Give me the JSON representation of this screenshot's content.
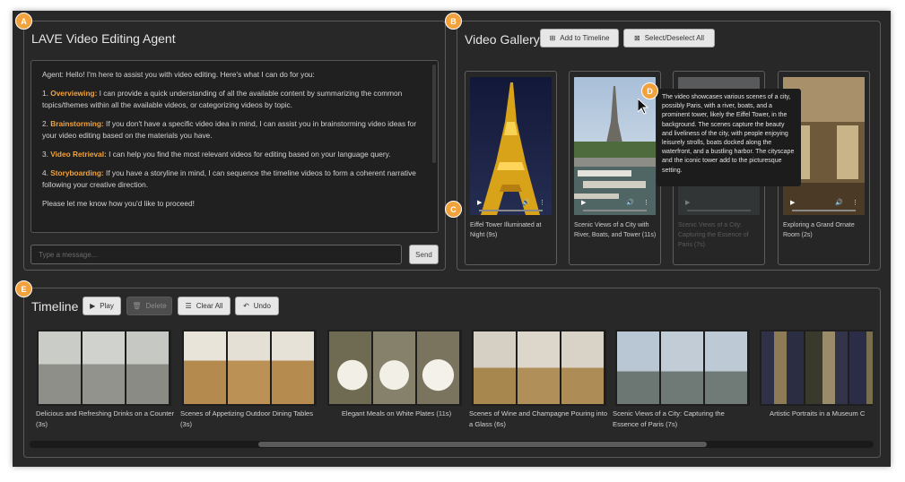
{
  "markers": [
    "A",
    "B",
    "C",
    "D",
    "E"
  ],
  "agent_panel": {
    "title": "LAVE Video Editing Agent",
    "intro": "Agent: Hello! I'm here to assist you with video editing. Here's what I can do for you:",
    "items": [
      {
        "num": "1.",
        "name": "Overviewing:",
        "text": " I can provide a quick understanding of all the available content by summarizing the common topics/themes within all the available videos, or categorizing videos by topic."
      },
      {
        "num": "2.",
        "name": "Brainstorming:",
        "text": " If you don't have a specific video idea in mind, I can assist you in brainstorming video ideas for your video editing based on the materials you have."
      },
      {
        "num": "3.",
        "name": "Video Retrieval:",
        "text": " I can help you find the most relevant videos for editing based on your language query."
      },
      {
        "num": "4.",
        "name": "Storyboarding:",
        "text": " If you have a storyline in mind, I can sequence the timeline videos to form a coherent narrative following your creative direction."
      }
    ],
    "closing": "Please let me know how you'd like to proceed!",
    "input_placeholder": "Type a message...",
    "send_label": "Send"
  },
  "gallery": {
    "title": "Video Gallery",
    "add_label": "Add to Timeline",
    "select_label": "Select/Deselect All",
    "videos": [
      {
        "caption": "Eiffel Tower Illuminated at Night (9s)"
      },
      {
        "caption": "Scenic Views of a City with River, Boats, and Tower (11s)"
      },
      {
        "caption": "Scenic Views of a City: Capturing the Essence of Paris (7s)"
      },
      {
        "caption": "Exploring a Grand Ornate Room (2s)"
      }
    ],
    "tooltip": "The video showcases various scenes of a city, possibly Paris, with a river, boats, and a prominent tower, likely the Eiffel Tower, in the background. The scenes capture the beauty and liveliness of the city, with people enjoying leisurely strolls, boats docked along the waterfront, and a bustling harbor. The cityscape and the iconic tower add to the picturesque setting."
  },
  "timeline": {
    "title": "Timeline",
    "play_label": "Play",
    "delete_label": "Delete",
    "clear_label": "Clear All",
    "undo_label": "Undo",
    "clips": [
      {
        "caption": "Delicious and Refreshing Drinks on a Counter (3s)"
      },
      {
        "caption": "Scenes of Appetizing Outdoor Dining Tables (3s)"
      },
      {
        "caption": "Elegant Meals on White Plates (11s)"
      },
      {
        "caption": "Scenes of Wine and Champagne Pouring into a Glass (6s)"
      },
      {
        "caption": "Scenic Views of a City: Capturing the Essence of Paris (7s)"
      },
      {
        "caption": "Artistic Portraits in a Museum C"
      }
    ]
  },
  "colors": {
    "accent": "#f2a23c",
    "app_background": "#282828",
    "button": "#e7e7e7"
  },
  "icons": [
    "play-icon",
    "volume-icon",
    "more-icon",
    "add-icon",
    "checkbox-icon",
    "trash-icon",
    "list-icon",
    "undo-icon",
    "mouse-pointer-icon"
  ]
}
